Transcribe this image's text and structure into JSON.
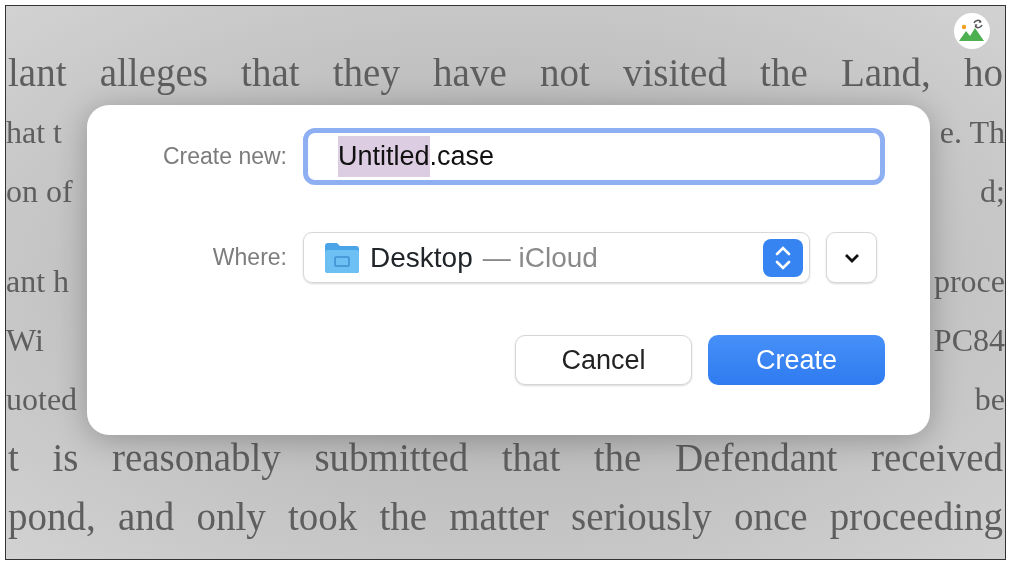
{
  "document": {
    "paragraphs": [
      {
        "lines": [
          {
            "left": "lant alleges that they have not visited the Land, ho"
          },
          {
            "left": "hat t",
            "right": "e. Th"
          },
          {
            "left": "on of",
            "right": "d;"
          }
        ]
      },
      {
        "lines": [
          {
            "left": "ant h",
            "right": "proce"
          },
          {
            "left": "Wi",
            "right": "PC84"
          },
          {
            "left": "uoted",
            "right": "be"
          },
          {
            "left": "t is reasonably submitted that the Defendant received"
          },
          {
            "left": "pond, and only took the matter seriously once proceeding"
          }
        ]
      }
    ]
  },
  "dialog": {
    "name_label": "Create new:",
    "name_field": {
      "text_selected": "Untitled",
      "text_rest": ".case",
      "focused": true
    },
    "where_label": "Where:",
    "where_popup": {
      "folder": "Desktop",
      "location": "— iCloud"
    },
    "expanded": false,
    "buttons": [
      {
        "label": "Cancel",
        "kind": "secondary"
      },
      {
        "label": "Create",
        "kind": "default"
      }
    ]
  }
}
